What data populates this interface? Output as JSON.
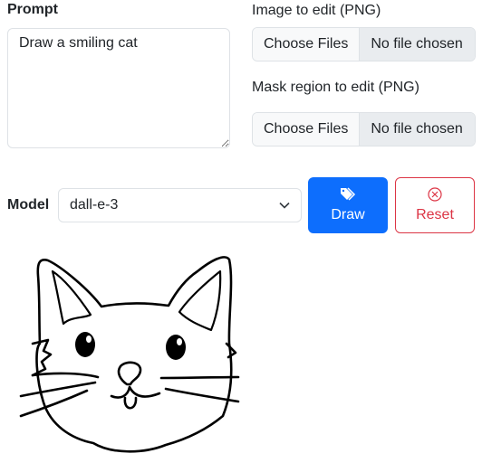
{
  "prompt": {
    "label": "Prompt",
    "value": "Draw a smiling cat"
  },
  "image_input": {
    "label": "Image to edit (PNG)",
    "button": "Choose Files",
    "status": "No file chosen"
  },
  "mask_input": {
    "label": "Mask region to edit (PNG)",
    "button": "Choose Files",
    "status": "No file chosen"
  },
  "model": {
    "label": "Model",
    "selected": "dall-e-3"
  },
  "draw_button": {
    "label": "Draw",
    "icon": "tags-icon",
    "color": "#0d6efd"
  },
  "reset_button": {
    "label": "Reset",
    "icon": "x-circle-icon",
    "color": "#dc3545"
  }
}
